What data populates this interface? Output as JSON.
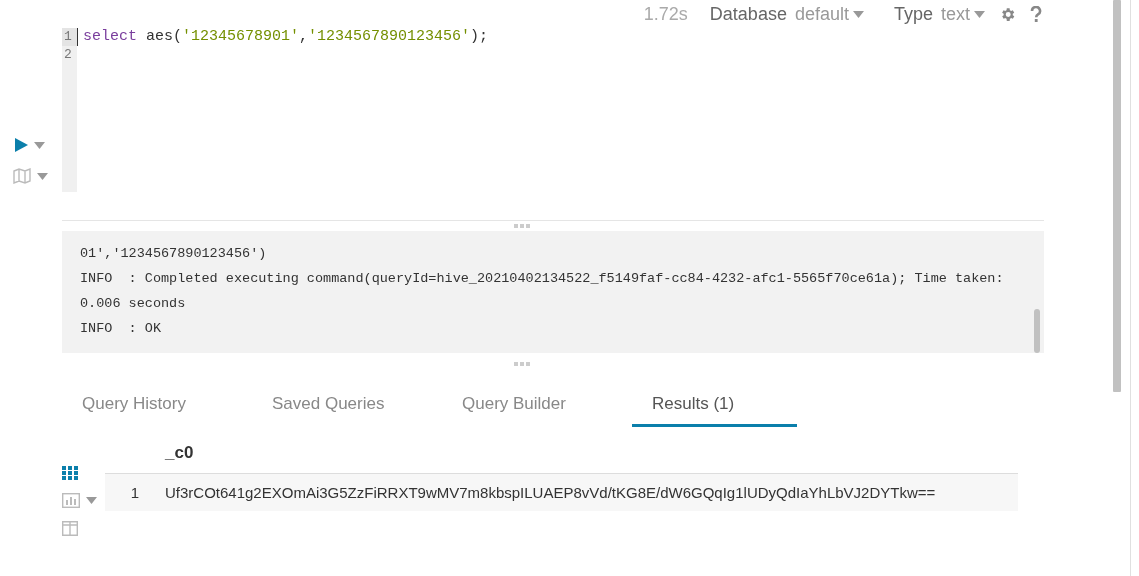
{
  "toolbar": {
    "duration": "1.72s",
    "database": {
      "label": "Database",
      "value": "default"
    },
    "type": {
      "label": "Type",
      "value": "text"
    }
  },
  "editor": {
    "lines": [
      {
        "number": "1",
        "active": true,
        "tokens": [
          {
            "kind": "keyword",
            "text": "select"
          },
          {
            "kind": "plain",
            "text": " aes("
          },
          {
            "kind": "string",
            "text": "'12345678901'"
          },
          {
            "kind": "plain",
            "text": ","
          },
          {
            "kind": "string",
            "text": "'1234567890123456'"
          },
          {
            "kind": "plain",
            "text": ");"
          }
        ]
      },
      {
        "number": "2",
        "active": false
      }
    ]
  },
  "log": {
    "lines": [
      "01','1234567890123456')",
      "INFO  : Completed executing command(queryId=hive_20210402134522_f5149faf-cc84-4232-afc1-5565f70ce61a); Time taken:",
      "0.006 seconds",
      "INFO  : OK"
    ]
  },
  "tabs": [
    {
      "label": "Query History",
      "selected": false
    },
    {
      "label": "Saved Queries",
      "selected": false
    },
    {
      "label": "Query Builder",
      "selected": false
    },
    {
      "label": "Results (1)",
      "selected": true
    }
  ],
  "results": {
    "columns": [
      "_c0"
    ],
    "rows": [
      {
        "number": "1",
        "cells": [
          "Uf3rCOt641g2EXOmAi3G5ZzFiRRXT9wMV7m8kbspILUAEP8vVd/tKG8E/dW6GQqIg1lUDyQdIaYhLbVJ2DYTkw=="
        ]
      }
    ]
  }
}
